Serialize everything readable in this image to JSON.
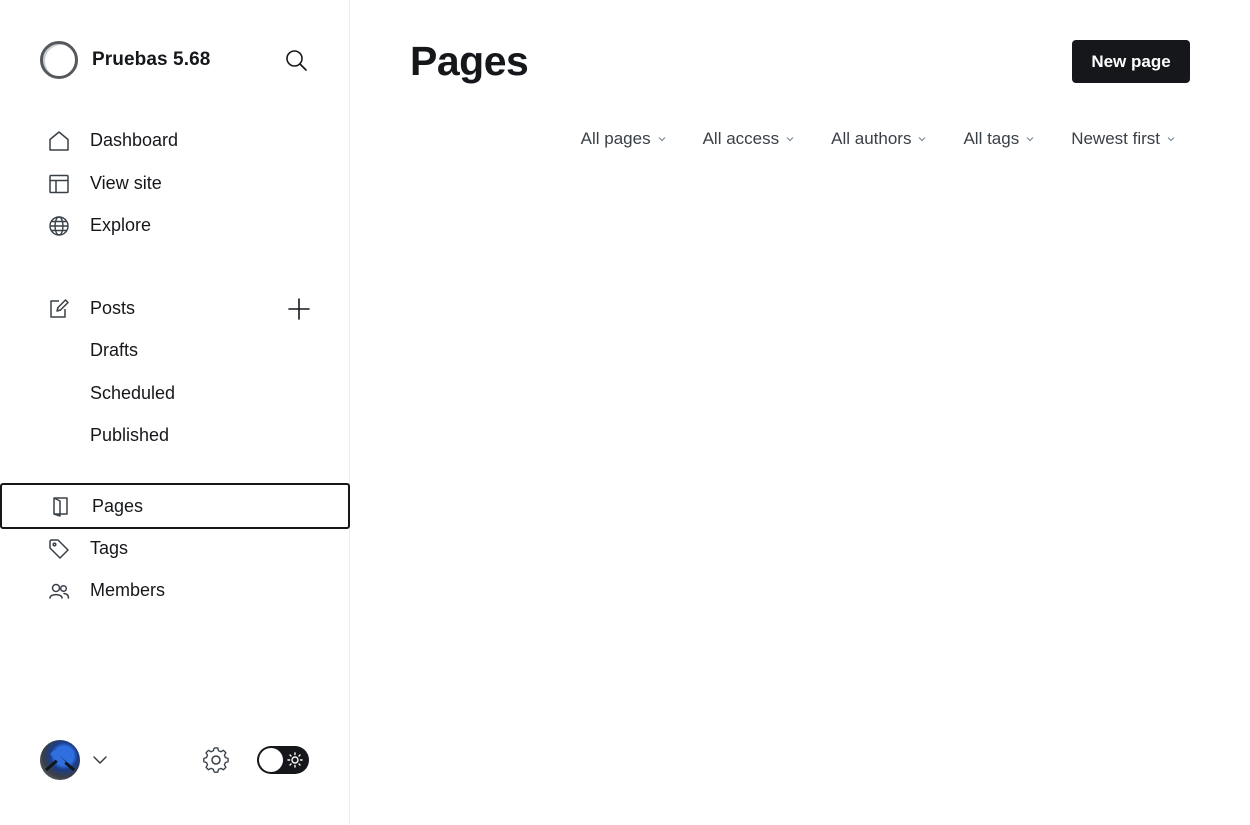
{
  "brand": {
    "name": "Pruebas 5.68"
  },
  "sidebar": {
    "primary": [
      {
        "label": "Dashboard",
        "icon": "home-icon"
      },
      {
        "label": "View site",
        "icon": "layout-icon"
      },
      {
        "label": "Explore",
        "icon": "globe-icon"
      }
    ],
    "posts": {
      "label": "Posts",
      "icon": "edit-icon",
      "sub": [
        "Drafts",
        "Scheduled",
        "Published"
      ]
    },
    "secondary": [
      {
        "label": "Pages",
        "icon": "page-icon",
        "active": true
      },
      {
        "label": "Tags",
        "icon": "tag-icon"
      },
      {
        "label": "Members",
        "icon": "members-icon"
      }
    ]
  },
  "main": {
    "title": "Pages",
    "new_button": "New page",
    "filters": [
      "All pages",
      "All access",
      "All authors",
      "All tags",
      "Newest first"
    ]
  },
  "colors": {
    "text": "#15171a",
    "button_bg": "#15171a",
    "button_text": "#ffffff",
    "border": "#ebeef0",
    "filter_text": "#394047"
  }
}
